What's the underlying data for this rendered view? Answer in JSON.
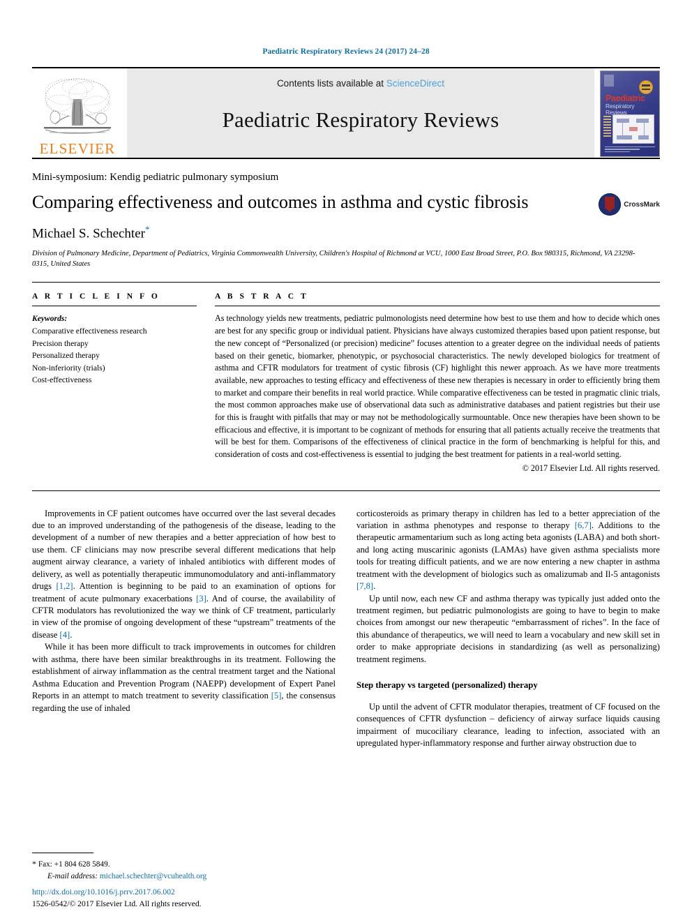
{
  "running_head": "Paediatric Respiratory Reviews 24 (2017) 24–28",
  "masthead": {
    "publisher_name": "ELSEVIER",
    "contents_prefix": "Contents lists available at ",
    "sciencedirect": "ScienceDirect",
    "journal_name": "Paediatric Respiratory Reviews",
    "cover": {
      "title": "Paediatric",
      "subtitle": "Respiratory Reviews"
    },
    "colors": {
      "link_teal": "#0c6f9c",
      "sciencedirect_blue": "#4d9fd6",
      "elsevier_orange": "#ef7d1a",
      "band_gray": "#e9e9e9"
    }
  },
  "title_block": {
    "symposium": "Mini-symposium: Kendig pediatric pulmonary symposium",
    "title": "Comparing effectiveness and outcomes in asthma and cystic fibrosis",
    "crossmark_label": "CrossMark",
    "author": "Michael S. Schechter",
    "author_marker": "*",
    "affiliation": "Division of Pulmonary Medicine, Department of Pediatrics, Virginia Commonwealth University, Children's Hospital of Richmond at VCU, 1000 East Broad Street, P.O. Box 980315, Richmond, VA 23298-0315, United States"
  },
  "article_info": {
    "heading": "A R T I C L E   I N F O",
    "keywords_label": "Keywords:",
    "keywords": [
      "Comparative effectiveness research",
      "Precision therapy",
      "Personalized therapy",
      "Non-inferiority (trials)",
      "Cost-effectiveness"
    ]
  },
  "abstract": {
    "heading": "A B S T R A C T",
    "text": "As technology yields new treatments, pediatric pulmonologists need determine how best to use them and how to decide which ones are best for any specific group or individual patient. Physicians have always customized therapies based upon patient response, but the new concept of “Personalized (or precision) medicine” focuses attention to a greater degree on the individual needs of patients based on their genetic, biomarker, phenotypic, or psychosocial characteristics. The newly developed biologics for treatment of asthma and CFTR modulators for treatment of cystic fibrosis (CF) highlight this newer approach. As we have more treatments available, new approaches to testing efficacy and effectiveness of these new therapies is necessary in order to efficiently bring them to market and compare their benefits in real world practice. While comparative effectiveness can be tested in pragmatic clinic trials, the most common approaches make use of observational data such as administrative databases and patient registries but their use for this is fraught with pitfalls that may or may not be methodologically surmountable. Once new therapies have been shown to be efficacious and effective, it is important to be cognizant of methods for ensuring that all patients actually receive the treatments that will be best for them. Comparisons of the effectiveness of clinical practice in the form of benchmarking is helpful for this, and consideration of costs and cost-effectiveness is essential to judging the best treatment for patients in a real-world setting.",
    "copyright": "© 2017 Elsevier Ltd. All rights reserved."
  },
  "body": {
    "left_column": {
      "p1_a": "Improvements in CF patient outcomes have occurred over the last several decades due to an improved understanding of the pathogenesis of the disease, leading to the development of a number of new therapies and a better appreciation of how best to use them. CF clinicians may now prescribe several different medications that help augment airway clearance, a variety of inhaled antibiotics with different modes of delivery, as well as potentially therapeutic immunomodulatory and anti-inflammatory drugs ",
      "p1_ref1": "[1,2]",
      "p1_b": ". Attention is beginning to be paid to an examination of options for treatment of acute pulmonary exacerbations ",
      "p1_ref2": "[3]",
      "p1_c": ". And of course, the availability of CFTR modulators has revolutionized the way we think of CF treatment, particularly in view of the promise of ongoing development of these “upstream” treatments of the disease ",
      "p1_ref3": "[4]",
      "p1_d": ".",
      "p2_a": "While it has been more difficult to track improvements in outcomes for children with asthma, there have been similar breakthroughs in its treatment. Following the establishment of airway inflammation as the central treatment target and the National Asthma Education and Prevention Program (NAEPP) development of Expert Panel Reports in an attempt to match treatment to severity classification ",
      "p2_ref1": "[5]",
      "p2_b": ", the consensus regarding the use of inhaled"
    },
    "right_column": {
      "p1_a": "corticosteroids as primary therapy in children has led to a better appreciation of the variation in asthma phenotypes and response to therapy ",
      "p1_ref1": "[6,7]",
      "p1_b": ". Additions to the therapeutic armamentarium such as long acting beta agonists (LABA) and both short- and long acting muscarinic agonists (LAMAs) have given asthma specialists more tools for treating difficult patients, and we are now entering a new chapter in asthma treatment with the development of biologics such as omalizumab and Il-5 antagonists ",
      "p1_ref2": "[7,8]",
      "p1_c": ".",
      "p2": "Up until now, each new CF and asthma therapy was typically just added onto the treatment regimen, but pediatric pulmonologists are going to have to begin to make choices from amongst our new therapeutic “embarrassment of riches”. In the face of this abundance of therapeutics, we will need to learn a vocabulary and new skill set in order to make appropriate decisions in standardizing (as well as personalizing) treatment regimens.",
      "heading": "Step therapy vs targeted (personalized) therapy",
      "p3": "Up until the advent of CFTR modulator therapies, treatment of CF focused on the consequences of CFTR dysfunction – deficiency of airway surface liquids causing impairment of mucociliary clearance, leading to infection, associated with an upregulated hyper-inflammatory response and further airway obstruction due to"
    }
  },
  "footnote": {
    "star": "*",
    "fax": "Fax: +1 804 628 5849.",
    "email_label": "E-mail address:",
    "email": "michael.schechter@vcuhealth.org"
  },
  "footer": {
    "doi": "http://dx.doi.org/10.1016/j.prrv.2017.06.002",
    "issn_line": "1526-0542/© 2017 Elsevier Ltd. All rights reserved."
  }
}
